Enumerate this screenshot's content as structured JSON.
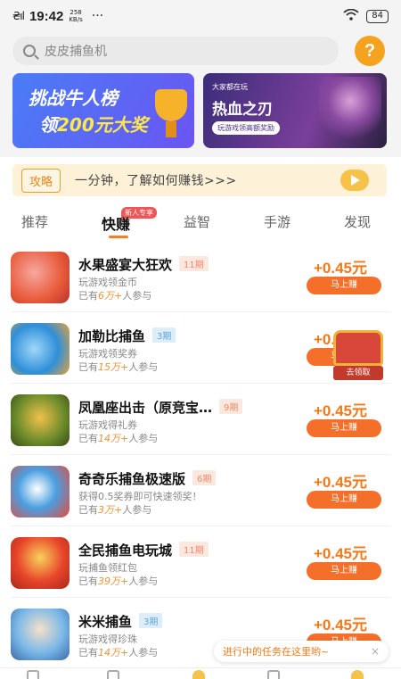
{
  "status_bar": {
    "signal": "₴ıl",
    "time": "19:42",
    "speed_top": "258",
    "speed_bottom": "KB/s",
    "dots": "···",
    "battery": "84"
  },
  "search": {
    "placeholder": "皮皮捕鱼机"
  },
  "help": {
    "label": "?"
  },
  "banners": [
    {
      "line1": "挑战牛人榜",
      "line2_prefix": "领",
      "line2_highlight": "200元大奖"
    },
    {
      "sub": "大家都在玩",
      "title": "热血之刃",
      "pill": "玩游戏领高额奖励"
    }
  ],
  "tip": {
    "tag": "攻略",
    "text": "一分钟，了解如何赚钱>>>"
  },
  "tabs": [
    {
      "label": "推荐"
    },
    {
      "label": "快赚",
      "active": true
    },
    {
      "label": "益智"
    },
    {
      "label": "手游"
    },
    {
      "label": "发现"
    }
  ],
  "new_badge": "新人专享",
  "games": [
    {
      "name": "水果盛宴大狂欢",
      "period": "11期",
      "period_color": "orange",
      "desc": "玩游戏领金币",
      "count_prefix": "已有",
      "count": "6万+",
      "count_suffix": "人参与",
      "reward": "+0.45元",
      "button": "马上赚",
      "thumb_color": "#e85a3a"
    },
    {
      "name": "加勒比捕鱼",
      "period": "3期",
      "period_color": "blue",
      "desc": "玩游戏领奖券",
      "count_prefix": "已有",
      "count": "15万+",
      "count_suffix": "人参与",
      "reward": "+0.45元",
      "button": "马上赚",
      "thumb_color": "#2f8fd8"
    },
    {
      "name": "凤凰座出击（原竞宝…",
      "period": "9期",
      "period_color": "orange",
      "desc": "玩游戏得礼券",
      "count_prefix": "已有",
      "count": "14万+",
      "count_suffix": "人参与",
      "reward": "+0.45元",
      "button": "马上赚",
      "thumb_color": "#6a8a2a"
    },
    {
      "name": "奇奇乐捕鱼极速版",
      "period": "6期",
      "period_color": "orange",
      "desc": "获得0.5奖券即可快速领奖！",
      "count_prefix": "已有",
      "count": "3万+",
      "count_suffix": "人参与",
      "reward": "+0.45元",
      "button": "马上赚",
      "thumb_color": "#4a9ee0"
    },
    {
      "name": "全民捕鱼电玩城",
      "period": "11期",
      "period_color": "orange",
      "desc": "玩捕鱼领红包",
      "count_prefix": "已有",
      "count": "39万+",
      "count_suffix": "人参与",
      "reward": "+0.45元",
      "button": "马上赚",
      "thumb_color": "#e8442a"
    },
    {
      "name": "米米捕鱼",
      "period": "3期",
      "period_color": "blue",
      "desc": "玩游戏得珍珠",
      "count_prefix": "已有",
      "count": "14万+",
      "count_suffix": "人参与",
      "reward": "+0.45元",
      "button": "马上赚",
      "thumb_color": "#7ab8e8"
    }
  ],
  "chest": {
    "label": "去领取"
  },
  "task_pill": {
    "text": "进行中的任务在这里哟~",
    "close": "×"
  },
  "colors": {
    "accent": "#f46f2a",
    "reward": "#f07a1a",
    "help": "#f5a21e"
  }
}
